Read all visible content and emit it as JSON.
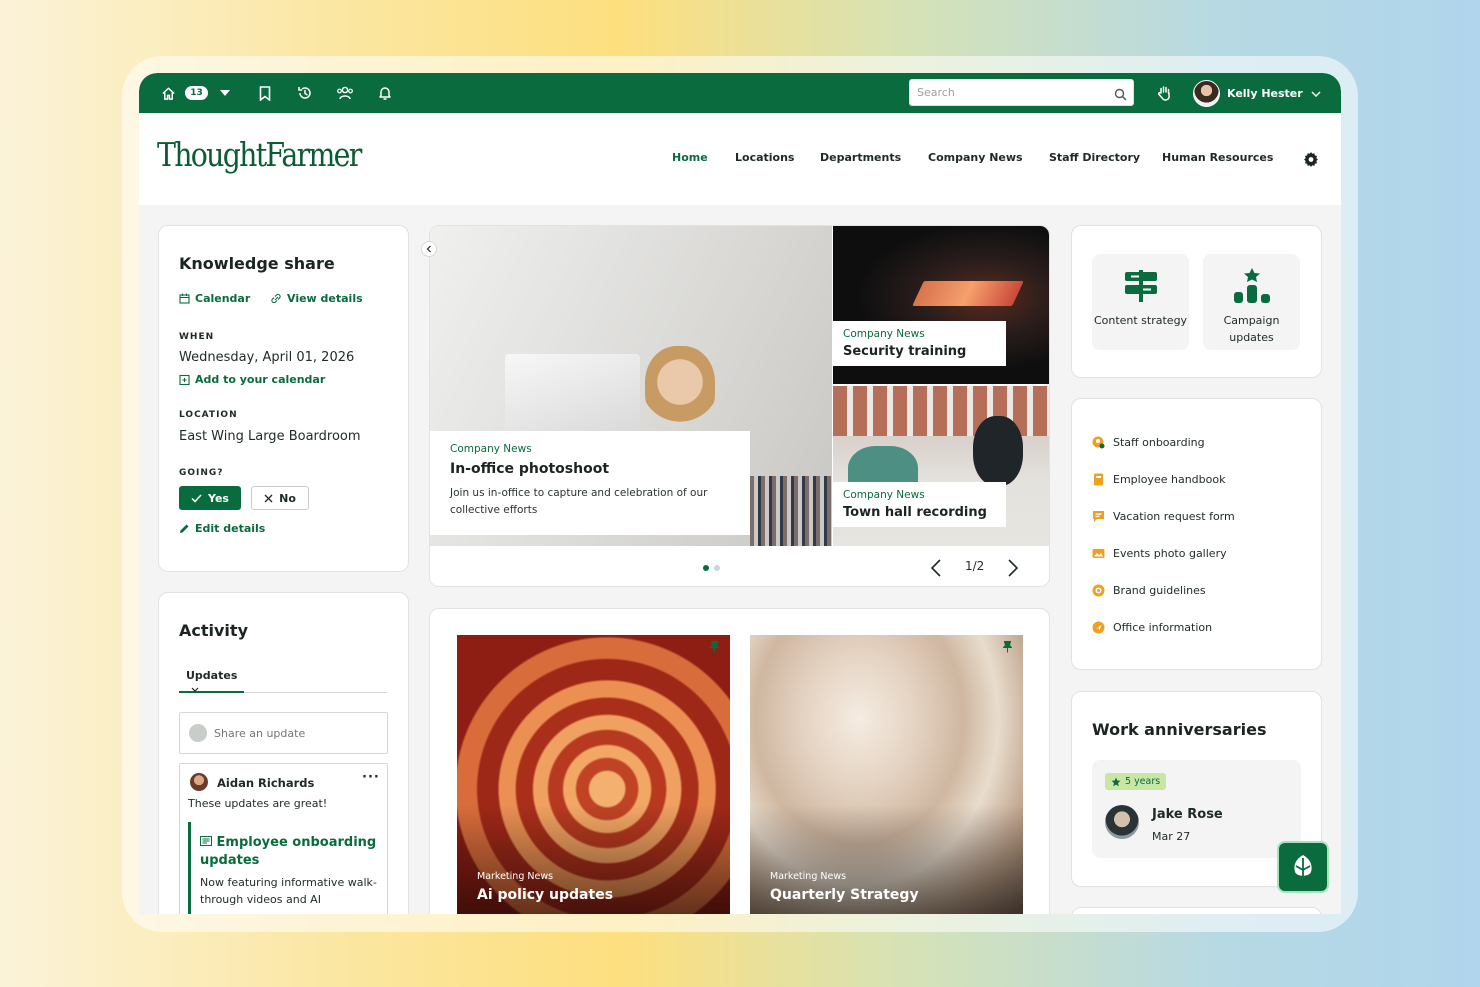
{
  "topbar": {
    "notification_count": "13",
    "search_placeholder": "Search",
    "user_name": "Kelly Hester"
  },
  "brand": {
    "logo_text": "ThoughtFarmer",
    "accent_color": "#0a6b3e"
  },
  "nav": {
    "items": [
      {
        "label": "Home",
        "active": true
      },
      {
        "label": "Locations"
      },
      {
        "label": "Departments"
      },
      {
        "label": "Company News"
      },
      {
        "label": "Staff Directory"
      },
      {
        "label": "Human Resources"
      }
    ]
  },
  "event": {
    "title": "Knowledge share",
    "calendar_link": "Calendar",
    "details_link": "View details",
    "when_label": "WHEN",
    "when_value": "Wednesday, April 01, 2026",
    "add_calendar": "Add to your calendar",
    "location_label": "LOCATION",
    "location_value": "East Wing Large Boardroom",
    "going_label": "GOING?",
    "yes_label": "Yes",
    "no_label": "No",
    "edit_label": "Edit details"
  },
  "activity": {
    "title": "Activity",
    "tab_label": "Updates",
    "share_placeholder": "Share an update",
    "post": {
      "author": "Aidan Richards",
      "text": "These updates are great!",
      "linked_title": "Employee onboarding updates",
      "linked_desc": "Now featuring informative walk-through videos and AI"
    }
  },
  "hero": {
    "main": {
      "category": "Company News",
      "title": "In-office photoshoot",
      "desc": "Join us in-office to capture and celebration of our collective efforts"
    },
    "top_right": {
      "category": "Company News",
      "title": "Security training"
    },
    "bottom_right": {
      "category": "Company News",
      "title": "Town hall recording"
    },
    "pager": "1/2"
  },
  "articles": [
    {
      "category": "Marketing News",
      "title": "Ai policy updates"
    },
    {
      "category": "Marketing News",
      "title": "Quarterly Strategy"
    }
  ],
  "quick_actions": [
    {
      "label": "Content strategy",
      "icon": "signpost-icon"
    },
    {
      "label": "Campaign updates",
      "icon": "podium-icon"
    }
  ],
  "links": [
    {
      "label": "Staff onboarding",
      "color": "#f0a020"
    },
    {
      "label": "Employee handbook",
      "color": "#f0a020"
    },
    {
      "label": "Vacation request form",
      "color": "#f0a020"
    },
    {
      "label": "Events photo gallery",
      "color": "#f0a020"
    },
    {
      "label": "Brand guidelines",
      "color": "#f0a020"
    },
    {
      "label": "Office information",
      "color": "#f0a020"
    }
  ],
  "anniversaries": {
    "title": "Work anniversaries",
    "badge": "5 years",
    "name": "Jake Rose",
    "date": "Mar 27"
  }
}
